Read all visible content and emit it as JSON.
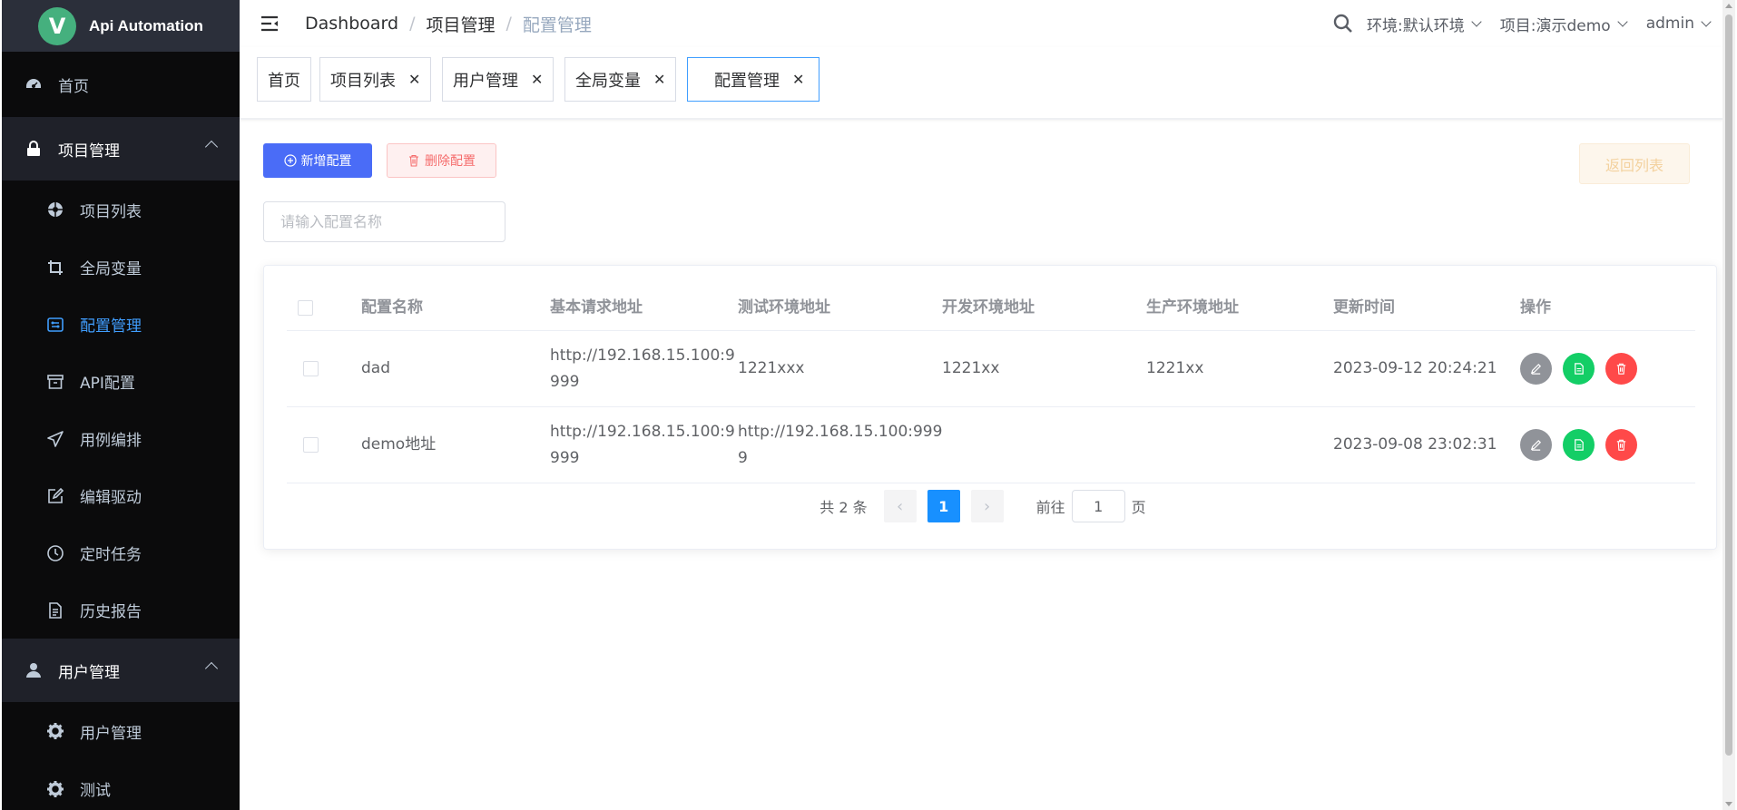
{
  "app": {
    "logo_letter": "V",
    "logo_text": "Api Automation"
  },
  "sidebar": {
    "home": {
      "label": "首页",
      "icon": "dashboard-icon"
    },
    "groups": [
      {
        "label": "项目管理",
        "icon": "lock-icon",
        "items": [
          {
            "label": "项目列表",
            "icon": "project-icon"
          },
          {
            "label": "全局变量",
            "icon": "crop-icon"
          },
          {
            "label": "配置管理",
            "icon": "config-icon",
            "active": true
          },
          {
            "label": "API配置",
            "icon": "box-icon"
          },
          {
            "label": "用例编排",
            "icon": "send-icon"
          },
          {
            "label": "编辑驱动",
            "icon": "edit-icon"
          },
          {
            "label": "定时任务",
            "icon": "clock-icon"
          },
          {
            "label": "历史报告",
            "icon": "document-icon"
          }
        ]
      },
      {
        "label": "用户管理",
        "icon": "user-icon",
        "items": [
          {
            "label": "用户管理",
            "icon": "gear-icon"
          },
          {
            "label": "测试",
            "icon": "gear-icon"
          }
        ]
      }
    ]
  },
  "header": {
    "breadcrumb": [
      "Dashboard",
      "项目管理",
      "配置管理"
    ],
    "env": "环境:默认环境",
    "project": "项目:演示demo",
    "user": "admin"
  },
  "tags": [
    {
      "label": "首页",
      "closable": false
    },
    {
      "label": "项目列表",
      "closable": true
    },
    {
      "label": "用户管理",
      "closable": true
    },
    {
      "label": "全局变量",
      "closable": true
    },
    {
      "label": "配置管理",
      "closable": true,
      "active": true
    }
  ],
  "toolbar": {
    "add_label": "新增配置",
    "delete_label": "删除配置",
    "back_label": "返回列表",
    "search_placeholder": "请输入配置名称"
  },
  "table": {
    "columns": [
      "配置名称",
      "基本请求地址",
      "测试环境地址",
      "开发环境地址",
      "生产环境地址",
      "更新时间",
      "操作"
    ],
    "rows": [
      {
        "name": "dad",
        "base_l1": "http://192.168.15.100:9",
        "base_l2": "999",
        "test_l1": "1221xxx",
        "test_l2": "",
        "dev": "1221xx",
        "prod": "1221xx",
        "updated": "2023-09-12 20:24:21"
      },
      {
        "name": "demo地址",
        "base_l1": "http://192.168.15.100:9",
        "base_l2": "999",
        "test_l1": "http://192.168.15.100:999",
        "test_l2": "9",
        "dev": "",
        "prod": "",
        "updated": "2023-09-08 23:02:31"
      }
    ]
  },
  "pagination": {
    "total_text": "共 2 条",
    "current_page": "1",
    "goto_prefix": "前往",
    "goto_value": "1",
    "goto_suffix": "页"
  },
  "colors": {
    "sidebar_bg": "#0b0b0c",
    "active_menu": "#409eff",
    "primary_button": "#4a6cf7",
    "edit_button": "#909399",
    "copy_button": "#13ce66",
    "delete_button": "#ff4949"
  }
}
